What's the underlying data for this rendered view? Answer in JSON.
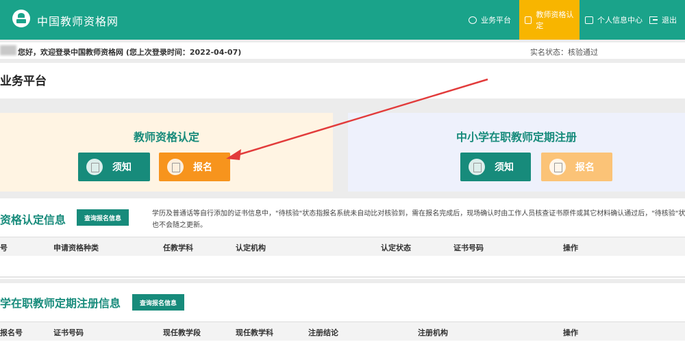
{
  "header": {
    "site_title": "中国教师资格网",
    "nav": [
      {
        "label": "业务平台",
        "icon": "globe-icon"
      },
      {
        "label": "教师资格认定",
        "icon": "monitor-icon"
      },
      {
        "label": "个人信息中心",
        "icon": "monitor-icon"
      },
      {
        "label": "退出",
        "icon": "exit-icon"
      }
    ],
    "active_color": "#f8b500",
    "bg_color": "#1aa38a"
  },
  "welcome": {
    "text": "您好，欢迎登录中国教师资格网 (您上次登录时间：2022-04-07)",
    "realname_status": "实名状态：核验通过"
  },
  "platform": {
    "title": "业务平台"
  },
  "cards": {
    "left": {
      "title": "教师资格认定",
      "notice_label": "须知",
      "apply_label": "报名"
    },
    "right": {
      "title": "中小学在职教师定期注册",
      "notice_label": "须知",
      "apply_label": "报名"
    }
  },
  "section1": {
    "title": "资格认定信息",
    "query_label": "查询报名信息",
    "notice": "学历及普通话等自行添加的证书信息中，\"待核验\"状态指报名系统未自动比对核验到，需在报名完成后，现场确认时由工作人员核查证书原件或其它材料确认通过后，\"待核验\"状态也不会随之更新。",
    "columns": [
      "号",
      "申请资格种类",
      "任教学科",
      "认定机构",
      "认定状态",
      "证书号码",
      "操作"
    ]
  },
  "section2": {
    "title": "学在职教师定期注册信息",
    "query_label": "查询报名信息",
    "columns": [
      "报名号",
      "证书号码",
      "现任教学段",
      "现任教学科",
      "注册结论",
      "注册机构",
      "操作"
    ]
  }
}
